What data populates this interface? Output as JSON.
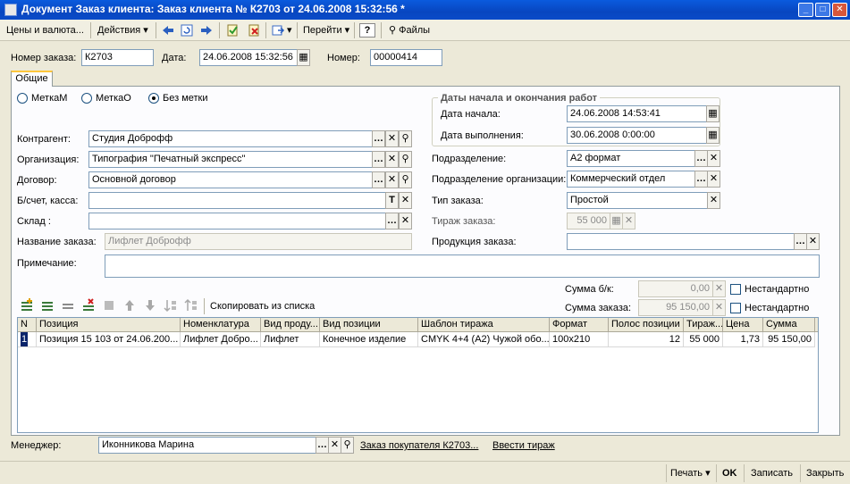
{
  "window": {
    "title": "Документ Заказ клиента: Заказ клиента № К2703 от 24.06.2008 15:32:56 *"
  },
  "toolbar": {
    "prices": "Цены и валюта...",
    "actions": "Действия",
    "goto": "Перейти",
    "help": "?",
    "files": "Файлы"
  },
  "header": {
    "order_no_label": "Номер заказа:",
    "order_no": "К2703",
    "date_label": "Дата:",
    "date": "24.06.2008 15:32:56",
    "number_label": "Номер:",
    "number": "00000414"
  },
  "tabs": {
    "general": "Общие"
  },
  "marks": {
    "m": "МеткаМ",
    "o": "МеткаО",
    "none": "Без метки"
  },
  "dates_group": {
    "title": "Даты начала и окончания работ",
    "start_label": "Дата начала:",
    "start": "24.06.2008 14:53:41",
    "end_label": "Дата выполнения:",
    "end": "30.06.2008  0:00:00"
  },
  "left": {
    "contractor_label": "Контрагент:",
    "contractor": "Студия Доброфф",
    "org_label": "Организация:",
    "org": "Типография \"Печатный экспресс\"",
    "contract_label": "Договор:",
    "contract": "Основной договор",
    "account_label": "Б/счет, касса:",
    "account": "",
    "warehouse_label": "Склад :",
    "warehouse": "",
    "order_name_label": "Название заказа:",
    "order_name": "Лифлет Доброфф",
    "note_label": "Примечание:",
    "note": ""
  },
  "right": {
    "division_label": "Подразделение:",
    "division": "А2 формат",
    "org_division_label": "Подразделение организации:",
    "org_division": "Коммерческий отдел",
    "order_type_label": "Тип заказа:",
    "order_type": "Простой",
    "circulation_label": "Тираж заказа:",
    "circulation": "55 000",
    "product_label": "Продукция заказа:",
    "product": ""
  },
  "sums": {
    "net_label": "Сумма б/к:",
    "net": "0,00",
    "total_label": "Сумма заказа:",
    "total": "95 150,00",
    "nonstandard": "Нестандартно"
  },
  "table_toolbar": {
    "copy_from_list": "Скопировать из списка"
  },
  "table": {
    "columns": [
      "N",
      "Позиция",
      "Номенклатура",
      "Вид проду...",
      "Вид позиции",
      "Шаблон тиража",
      "Формат",
      "Полос позиции",
      "Тираж...",
      "Цена",
      "Сумма"
    ],
    "rows": [
      [
        "1",
        "Позиция 15 103 от 24.06.200...",
        "Лифлет Добро...",
        "Лифлет",
        "Конечное изделие",
        "CMYK 4+4 (A2) Чужой обо...",
        "100x210",
        "12",
        "55 000",
        "1,73",
        "95 150,00"
      ]
    ]
  },
  "footer": {
    "manager_label": "Менеджер:",
    "manager": "Иконникова Марина",
    "link_order": "Заказ покупателя К2703...",
    "link_circulation": "Ввести тираж"
  },
  "bottom": {
    "print": "Печать",
    "ok": "OK",
    "save": "Записать",
    "close": "Закрыть"
  }
}
